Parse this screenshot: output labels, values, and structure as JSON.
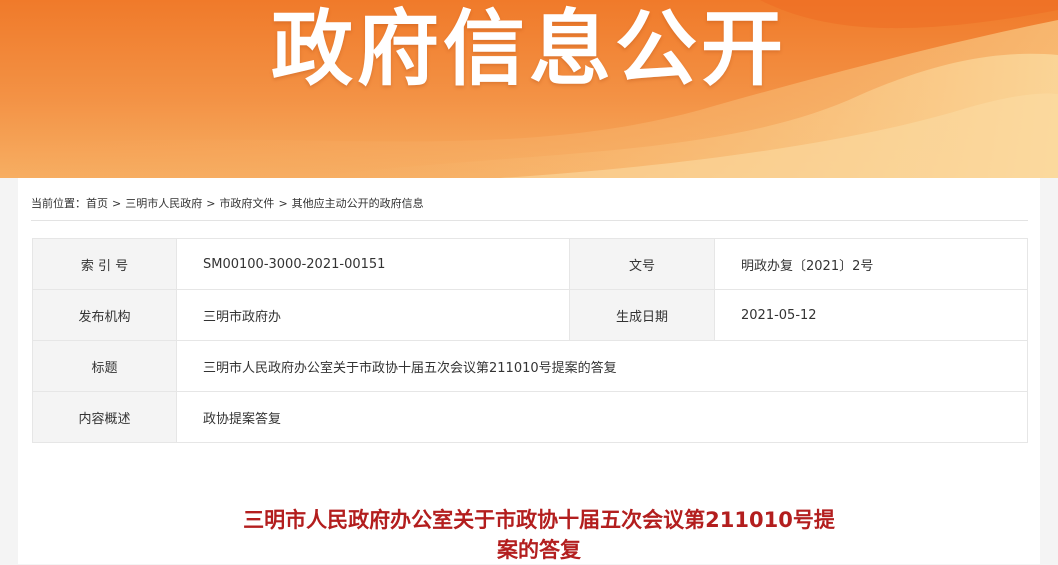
{
  "banner": {
    "title": "政府信息公开"
  },
  "breadcrumb": {
    "prefix": "当前位置：",
    "items": [
      "首页",
      "三明市人民政府",
      "市政府文件",
      "其他应主动公开的政府信息"
    ],
    "separator": ">"
  },
  "meta": {
    "index_label": "索 引 号",
    "index_value": "SM00100-3000-2021-00151",
    "docno_label": "文号",
    "docno_value": "明政办复〔2021〕2号",
    "issuer_label": "发布机构",
    "issuer_value": "三明市政府办",
    "date_label": "生成日期",
    "date_value": "2021-05-12",
    "title_label": "标题",
    "title_value": "三明市人民政府办公室关于市政协十届五次会议第211010号提案的答复",
    "summary_label": "内容概述",
    "summary_value": "政协提案答复"
  },
  "article": {
    "title_line1": "三明市人民政府办公室关于市政协十届五次会议第211010号提",
    "title_line2": "案的答复"
  },
  "colors": {
    "banner": "#f07a2a",
    "title_red": "#b31e1e"
  }
}
